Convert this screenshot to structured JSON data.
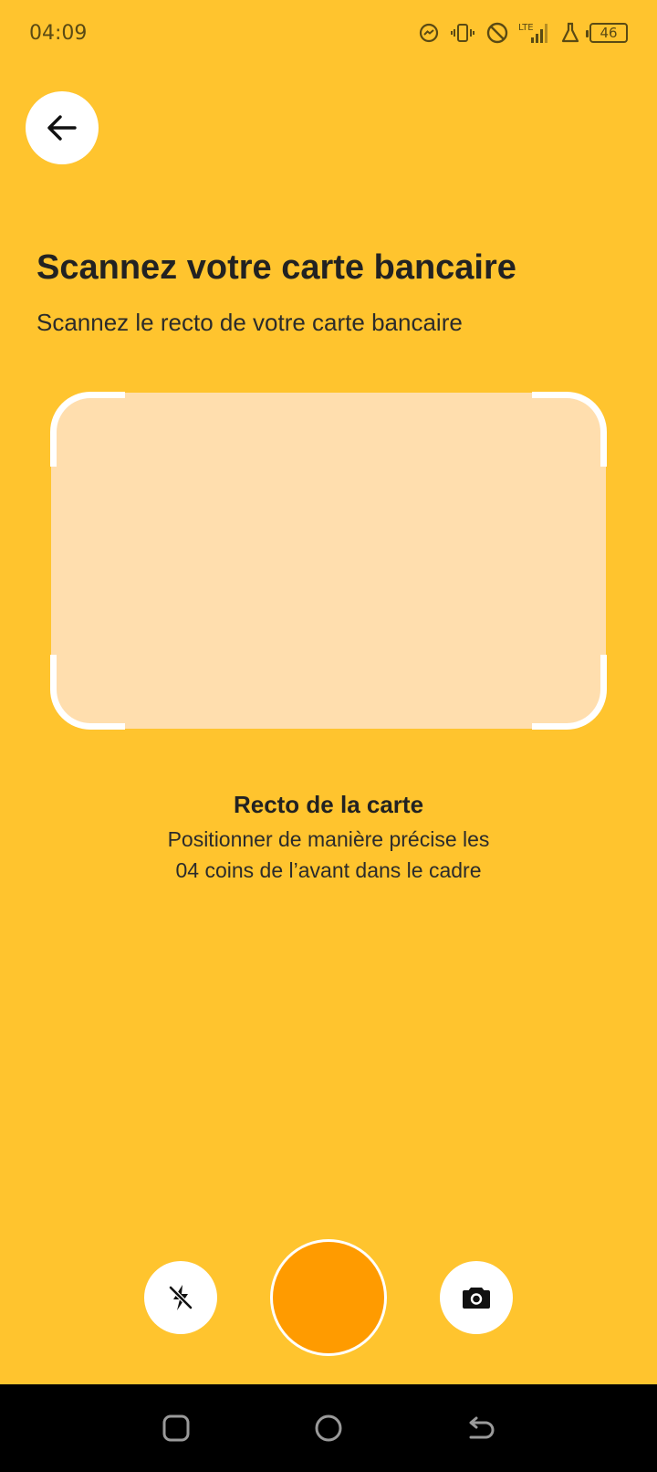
{
  "status_bar": {
    "time": "04:09",
    "network": "LTE",
    "battery": "46"
  },
  "header": {
    "title": "Scannez votre carte bancaire",
    "subtitle": "Scannez le recto de votre carte bancaire"
  },
  "instructions": {
    "title": "Recto de la carte",
    "line1": "Positionner de manière précise les",
    "line2": "04 coins de l’avant dans le cadre"
  },
  "controls": {
    "flash_icon": "flash-off-icon",
    "capture_icon": "shutter",
    "switch_icon": "camera-icon"
  },
  "colors": {
    "background": "#FFC42E",
    "frame_fill": "#FFDEAE",
    "shutter": "#FF9B00"
  }
}
